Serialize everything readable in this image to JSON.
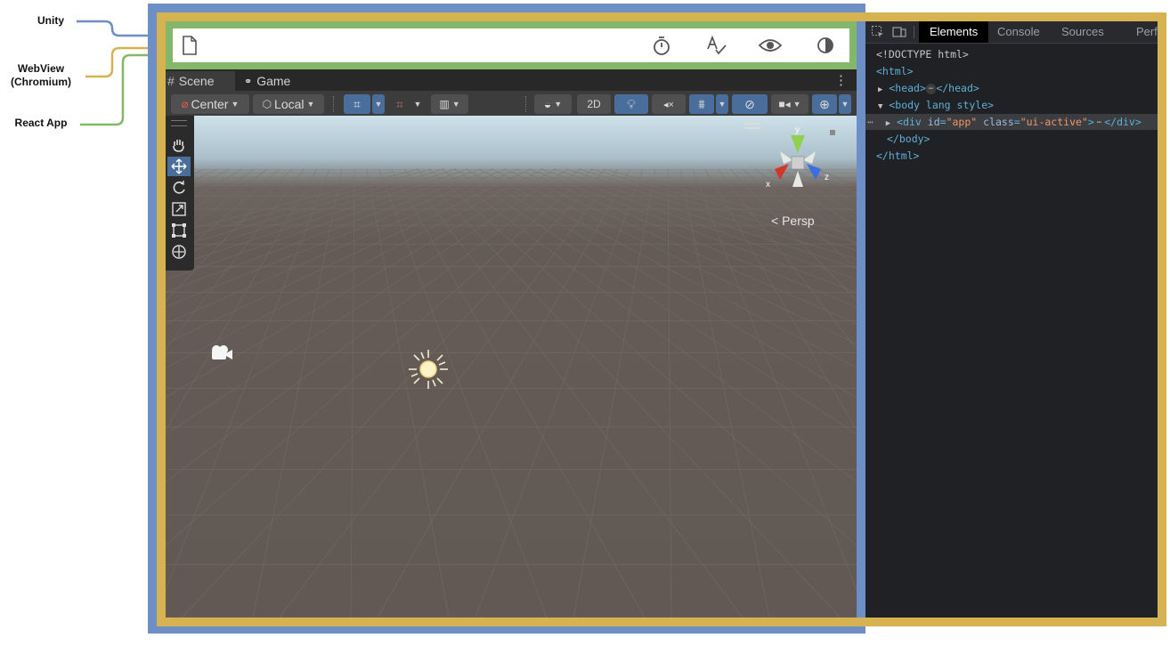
{
  "annotations": {
    "unity": "Unity",
    "webview_line1": "WebView",
    "webview_line2": "(Chromium)",
    "react": "React App"
  },
  "colors": {
    "unity": "#6d8fc5",
    "webview": "#d6b251",
    "react": "#83b86b"
  },
  "react_toolbar": {
    "icons": [
      "file-icon",
      "stopwatch-icon",
      "spellcheck-icon",
      "eye-icon",
      "contrast-icon"
    ]
  },
  "unity_editor": {
    "tabs": [
      "Scene",
      "Game"
    ],
    "toolbar": {
      "pivot": "Center",
      "space": "Local",
      "mode_2d": "2D"
    },
    "scene": {
      "projection": "Persp",
      "axes": {
        "x": "x",
        "y": "y",
        "z": "z"
      }
    }
  },
  "devtools": {
    "tabs": [
      "Elements",
      "Console",
      "Sources",
      "Perf"
    ],
    "lines": [
      "<!DOCTYPE html>",
      "<html>",
      "<head>",
      "</head>",
      "<body lang style>",
      "<div id=\"app\" class=\"ui-active\">",
      "</div>",
      "</body>",
      "</html>"
    ]
  }
}
